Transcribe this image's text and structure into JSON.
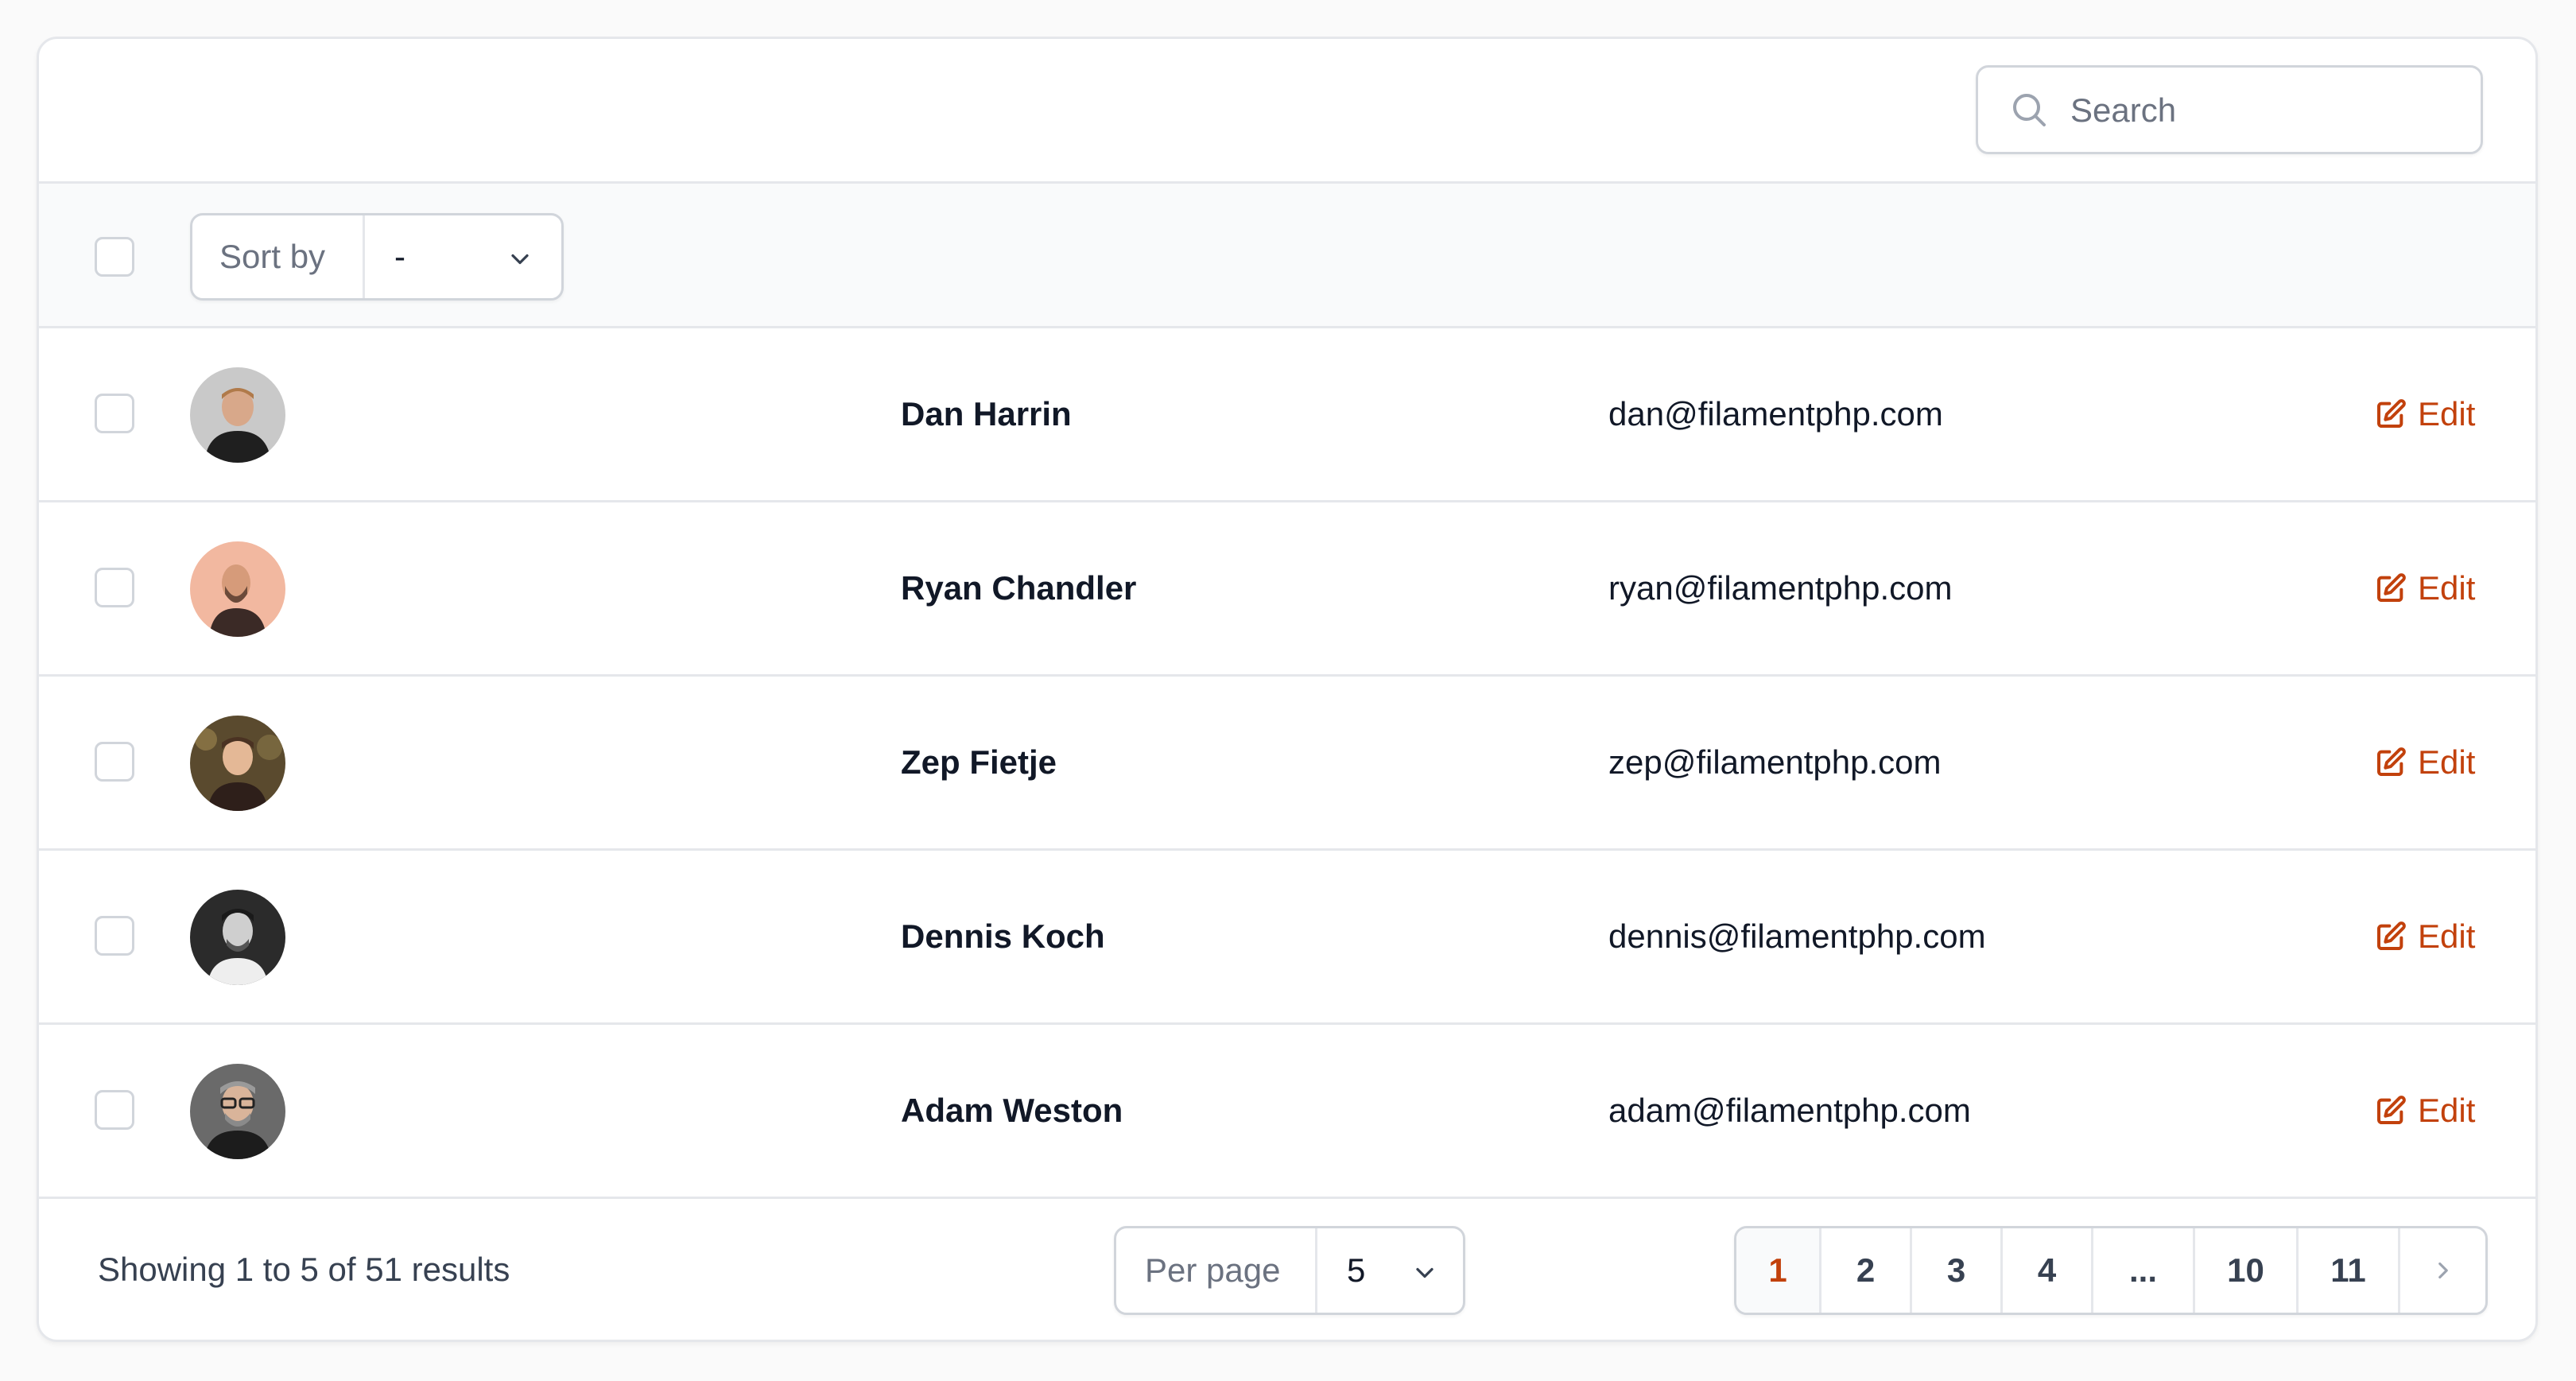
{
  "search": {
    "placeholder": "Search",
    "icon": "search-icon"
  },
  "toolbar": {
    "sort_label": "Sort by",
    "sort_value": "-"
  },
  "rows": [
    {
      "name": "Dan Harrin",
      "email": "dan@filamentphp.com",
      "action": "Edit"
    },
    {
      "name": "Ryan Chandler",
      "email": "ryan@filamentphp.com",
      "action": "Edit"
    },
    {
      "name": "Zep Fietje",
      "email": "zep@filamentphp.com",
      "action": "Edit"
    },
    {
      "name": "Dennis Koch",
      "email": "dennis@filamentphp.com",
      "action": "Edit"
    },
    {
      "name": "Adam Weston",
      "email": "adam@filamentphp.com",
      "action": "Edit"
    }
  ],
  "footer": {
    "showing": "Showing 1 to 5 of 51 results",
    "per_page_label": "Per page",
    "per_page_value": "5",
    "pages": [
      "1",
      "2",
      "3",
      "4",
      "...",
      "10",
      "11"
    ],
    "active_page": "1"
  },
  "colors": {
    "accent": "#c2410c",
    "border": "#e5e7eb"
  }
}
